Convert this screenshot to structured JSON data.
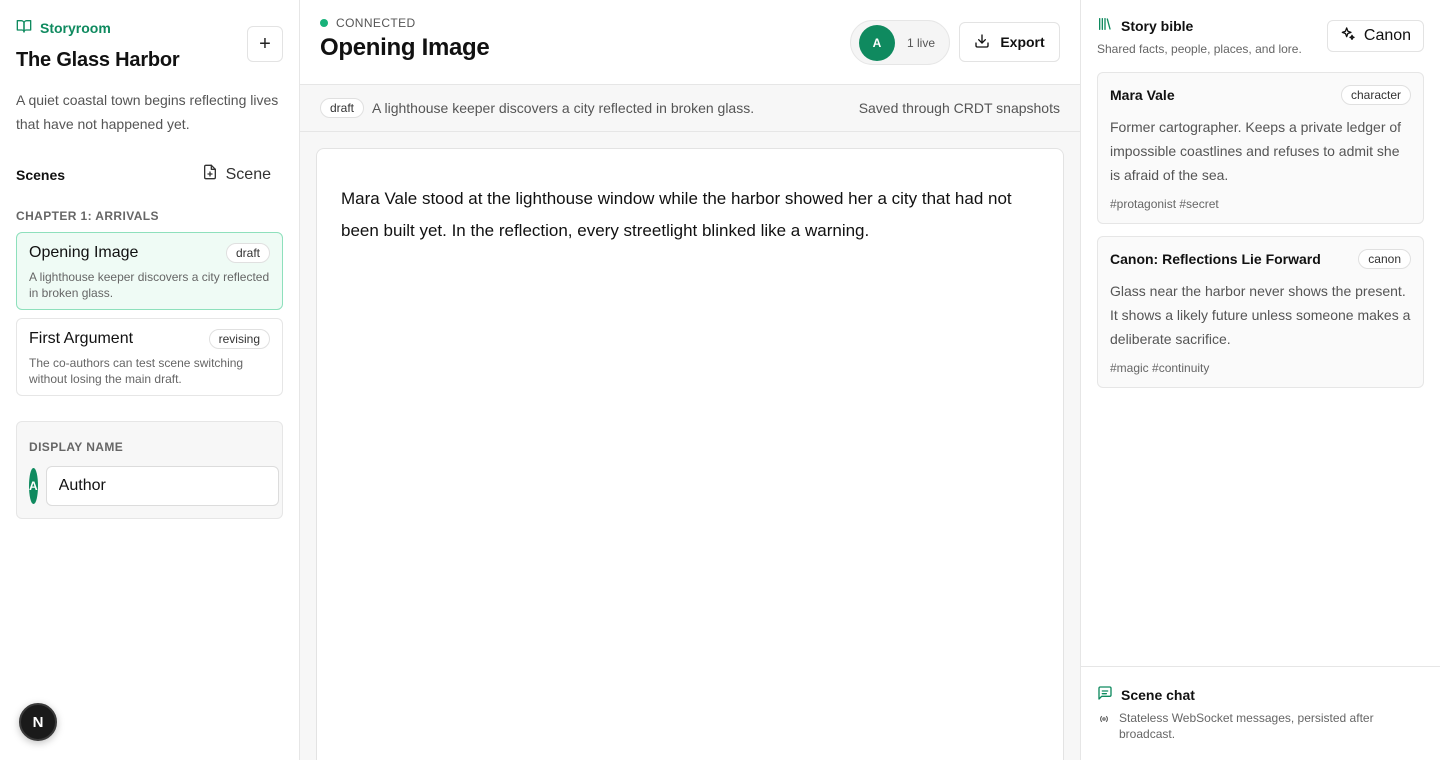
{
  "sidebar": {
    "brand": "Storyroom",
    "story_title": "The Glass Harbor",
    "add_label": "+",
    "story_description": "A quiet coastal town begins reflecting lives that have not happened yet.",
    "scenes_label": "Scenes",
    "scene_add_label": "Scene",
    "chapter_label": "CHAPTER 1: ARRIVALS",
    "scenes": [
      {
        "name": "Opening Image",
        "status": "draft",
        "description": "A lighthouse keeper discovers a city reflected in broken glass.",
        "active": true
      },
      {
        "name": "First Argument",
        "status": "revising",
        "description": "The co-authors can test scene switching without losing the main draft.",
        "active": false
      }
    ],
    "display_name": {
      "label": "DISPLAY NAME",
      "avatar_initial": "A",
      "value": "Author"
    }
  },
  "dev_badge": "N",
  "main": {
    "status": "CONNECTED",
    "title": "Opening Image",
    "presence": {
      "avatar_initial": "A",
      "live_label": "1 live"
    },
    "export_label": "Export",
    "subbar": {
      "status_badge": "draft",
      "summary": "A lighthouse keeper discovers a city reflected in broken glass.",
      "saved": "Saved through CRDT snapshots"
    },
    "editor_text": "Mara Vale stood at the lighthouse window while the harbor showed her a city that had not been built yet. In the reflection, every streetlight blinked like a warning."
  },
  "panel": {
    "title": "Story bible",
    "subtitle": "Shared facts, people, places, and lore.",
    "canon_label": "Canon",
    "entries": [
      {
        "name": "Mara Vale",
        "kind": "character",
        "body": "Former cartographer. Keeps a private ledger of impossible coastlines and refuses to admit she is afraid of the sea.",
        "tags": "#protagonist #secret"
      },
      {
        "name": "Canon: Reflections Lie Forward",
        "kind": "canon",
        "body": "Glass near the harbor never shows the present. It shows a likely future unless someone makes a deliberate sacrifice.",
        "tags": "#magic #continuity"
      }
    ],
    "chat": {
      "title": "Scene chat",
      "subtitle": "Stateless WebSocket messages, persisted after broadcast."
    }
  },
  "colors": {
    "accent": "#0f8a5f",
    "status_dot": "#18b27a",
    "active_scene_bg": "#effbf5",
    "active_scene_border": "#8ee0bc"
  },
  "icons": {
    "brand": "book-open-icon",
    "scene_add": "file-plus-icon",
    "export": "download-icon",
    "bible": "library-icon",
    "canon": "sparkles-icon",
    "chat": "message-square-icon",
    "chat_sub": "radio-icon"
  }
}
